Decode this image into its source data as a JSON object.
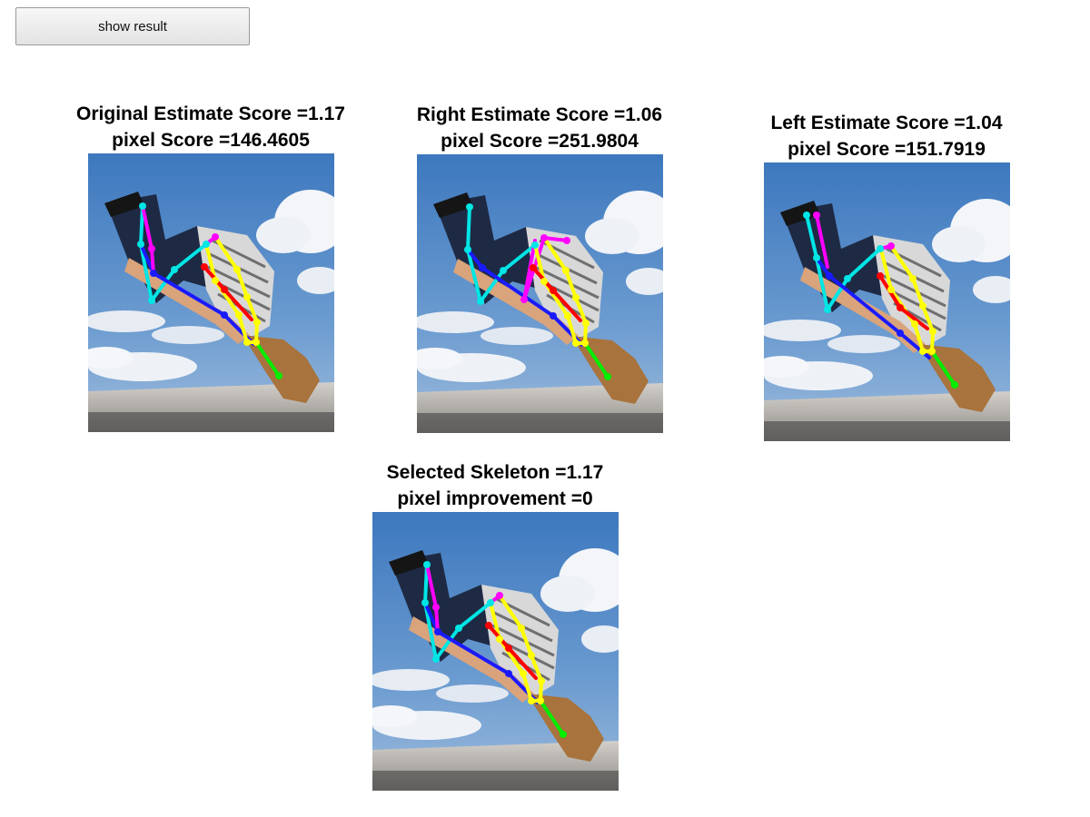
{
  "toolbar": {
    "show_result_label": "show result"
  },
  "panels": {
    "original": {
      "line1": "Original Estimate Score =1.17",
      "line2": "pixel Score =146.4605"
    },
    "right": {
      "line1": "Right Estimate Score =1.06",
      "line2": "pixel Score =251.9804"
    },
    "left": {
      "line1": "Left Estimate Score =1.04",
      "line2": "pixel Score =151.7919"
    },
    "selected": {
      "line1": "Selected Skeleton =1.17",
      "line2": "pixel improvement =0"
    }
  },
  "colors": {
    "sky": "#4f86c3",
    "cloud": "#f1f4f8",
    "bridge": "#b9b6b1",
    "skeleton_cyan": "#00e5e5",
    "skeleton_magenta": "#ff00ff",
    "skeleton_yellow": "#ffff00",
    "skeleton_red": "#ff0000",
    "skeleton_blue": "#1a1aff",
    "skeleton_green": "#00ee00"
  }
}
